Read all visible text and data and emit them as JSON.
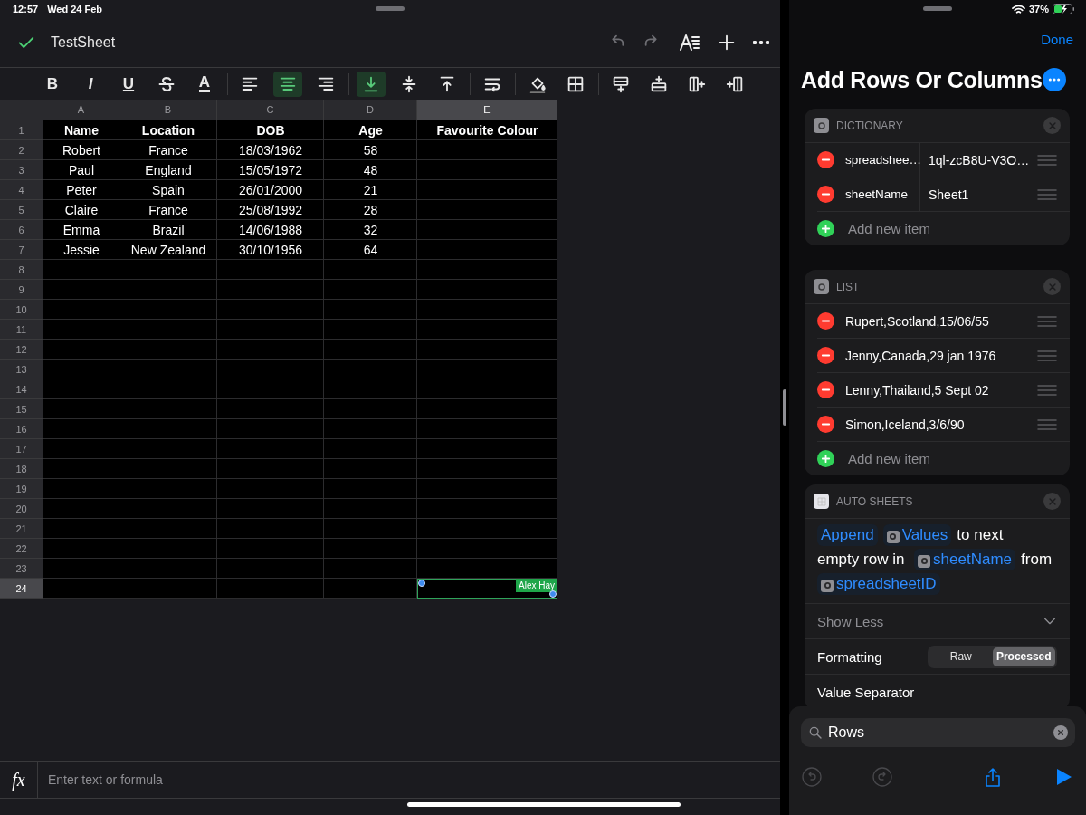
{
  "status_bar": {
    "time": "12:57",
    "date": "Wed 24 Feb",
    "battery": "37%"
  },
  "sheet": {
    "title": "TestSheet",
    "toolbar": {
      "groups": [
        {
          "buttons": [
            {
              "kind": "bold",
              "glyph": "B",
              "selected": false
            },
            {
              "kind": "italic",
              "glyph": "I",
              "selected": false
            },
            {
              "kind": "underline",
              "glyph": "U",
              "selected": false
            },
            {
              "kind": "strike",
              "selected": false
            },
            {
              "kind": "text-color",
              "glyph": "A",
              "selected": false
            }
          ]
        },
        {
          "buttons": [
            {
              "kind": "align-left",
              "selected": false
            },
            {
              "kind": "align-center",
              "selected": true
            },
            {
              "kind": "align-right",
              "selected": false
            }
          ]
        },
        {
          "buttons": [
            {
              "kind": "valign-bottom",
              "selected": true
            },
            {
              "kind": "valign-middle",
              "selected": false
            },
            {
              "kind": "valign-top",
              "selected": false
            }
          ]
        },
        {
          "buttons": [
            {
              "kind": "wrap",
              "selected": false
            }
          ]
        },
        {
          "buttons": [
            {
              "kind": "fill",
              "selected": false
            },
            {
              "kind": "borders",
              "selected": false
            }
          ]
        },
        {
          "buttons": [
            {
              "kind": "insert-row-above",
              "selected": false
            },
            {
              "kind": "insert-row-below",
              "selected": false
            },
            {
              "kind": "insert-column-left",
              "selected": false
            },
            {
              "kind": "insert-column-right",
              "selected": false
            }
          ]
        }
      ]
    },
    "columns": [
      {
        "label": "A",
        "selected": false
      },
      {
        "label": "B",
        "selected": false
      },
      {
        "label": "C",
        "selected": false
      },
      {
        "label": "D",
        "selected": false
      },
      {
        "label": "E",
        "selected": true
      }
    ],
    "rows": [
      {
        "label": "1",
        "selected": false,
        "bold": true,
        "cells": [
          "Name",
          "Location",
          "DOB",
          "Age",
          "Favourite Colour"
        ]
      },
      {
        "label": "2",
        "selected": false,
        "bold": false,
        "cells": [
          "Robert",
          "France",
          "18/03/1962",
          "58"
        ]
      },
      {
        "label": "3",
        "selected": false,
        "bold": false,
        "cells": [
          "Paul",
          "England",
          "15/05/1972",
          "48"
        ]
      },
      {
        "label": "4",
        "selected": false,
        "bold": false,
        "cells": [
          "Peter",
          "Spain",
          "26/01/2000",
          "21"
        ]
      },
      {
        "label": "5",
        "selected": false,
        "bold": false,
        "cells": [
          "Claire",
          "France",
          "25/08/1992",
          "28"
        ]
      },
      {
        "label": "6",
        "selected": false,
        "bold": false,
        "cells": [
          "Emma",
          "Brazil",
          "14/06/1988",
          "32"
        ]
      },
      {
        "label": "7",
        "selected": false,
        "bold": false,
        "cells": [
          "Jessie",
          "New Zealand",
          "30/10/1956",
          "64"
        ]
      },
      {
        "label": "8",
        "selected": false
      },
      {
        "label": "9",
        "selected": false
      },
      {
        "label": "10",
        "selected": false
      },
      {
        "label": "11",
        "selected": false
      },
      {
        "label": "12",
        "selected": false
      },
      {
        "label": "13",
        "selected": false
      },
      {
        "label": "14",
        "selected": false
      },
      {
        "label": "15",
        "selected": false
      },
      {
        "label": "16",
        "selected": false
      },
      {
        "label": "17",
        "selected": false
      },
      {
        "label": "18",
        "selected": false
      },
      {
        "label": "19",
        "selected": false
      },
      {
        "label": "20",
        "selected": false
      },
      {
        "label": "21",
        "selected": false
      },
      {
        "label": "22",
        "selected": false
      },
      {
        "label": "23",
        "selected": false
      },
      {
        "label": "24",
        "selected": true
      }
    ],
    "cursor_label": "Alex Hay",
    "formula_bar": {
      "label": "fx",
      "placeholder": "Enter text or formula"
    }
  },
  "shortcut": {
    "done": "Done",
    "title": "Add Rows Or Columns",
    "actions": [
      {
        "kind": "dictionary",
        "title": "DICTIONARY",
        "items": [
          {
            "key": "spreadshee…",
            "value": "1ql-zcB8U-V3O…"
          },
          {
            "key": "sheetName",
            "value": "Sheet1"
          }
        ],
        "add_label": "Add new item"
      },
      {
        "kind": "list",
        "title": "LIST",
        "items": [
          "Rupert,Scotland,15/06/55",
          "Jenny,Canada,29 jan 1976",
          "Lenny,Thailand,5 Sept 02",
          "Simon,Iceland,3/6/90"
        ],
        "add_label": "Add new item"
      },
      {
        "kind": "auto-sheets",
        "title": "AUTO SHEETS",
        "sentence": [
          {
            "kind": "action",
            "text": "Append"
          },
          {
            "kind": "variable",
            "text": "Values"
          },
          {
            "kind": "text",
            "text": "to next"
          },
          {
            "kind": "text",
            "text": "empty row in"
          },
          {
            "kind": "variable",
            "text": "sheetName"
          },
          {
            "kind": "text",
            "text": "from"
          },
          {
            "kind": "variable",
            "text": "spreadsheetID"
          }
        ],
        "toggle": "Show Less",
        "params": [
          {
            "kind": "segmented",
            "label": "Formatting",
            "options": [
              {
                "label": "Raw",
                "selected": false
              },
              {
                "label": "Processed",
                "selected": true
              }
            ]
          },
          {
            "kind": "plain",
            "label": "Value Separator"
          }
        ]
      }
    ],
    "search": {
      "value": "Rows"
    }
  }
}
